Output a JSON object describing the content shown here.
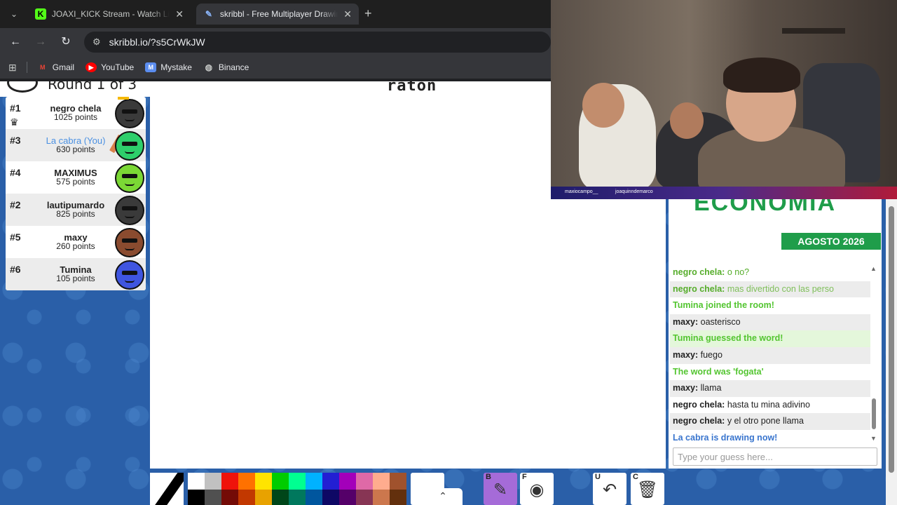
{
  "browser": {
    "tabs": [
      {
        "title": "JOAXI_KICK Stream - Watch Live",
        "favicon": "kick-icon"
      },
      {
        "title": "skribbl - Free Multiplayer Drawing",
        "favicon": "skribbl-icon"
      }
    ],
    "url": "skribbl.io/?s5CrWkJW",
    "bookmarks": [
      {
        "label": "Gmail",
        "icon": "gmail-icon"
      },
      {
        "label": "YouTube",
        "icon": "youtube-icon"
      },
      {
        "label": "Mystake",
        "icon": "mystake-icon"
      },
      {
        "label": "Binance",
        "icon": "globe-icon"
      }
    ]
  },
  "game": {
    "round_text": "Round 1 of 3",
    "word_hint": "raton",
    "players": [
      {
        "rank": "#1",
        "name": "negro chela",
        "points": "1025 points",
        "avatar_color": "#3a3a3a",
        "you": false,
        "owner": true
      },
      {
        "rank": "#3",
        "name": "La cabra (You)",
        "points": "630 points",
        "avatar_color": "#2ecf6b",
        "you": true,
        "drawing": true
      },
      {
        "rank": "#4",
        "name": "MAXIMUS",
        "points": "575 points",
        "avatar_color": "#7bd835",
        "you": false
      },
      {
        "rank": "#2",
        "name": "lautipumardo",
        "points": "825 points",
        "avatar_color": "#3a3a3a",
        "you": false
      },
      {
        "rank": "#5",
        "name": "maxy",
        "points": "260 points",
        "avatar_color": "#8a4b2f",
        "you": false
      },
      {
        "rank": "#6",
        "name": "Tumina",
        "points": "105 points",
        "avatar_color": "#3f55e0",
        "you": false
      }
    ]
  },
  "chat": {
    "banner_title": "ECONOMIA",
    "banner_date": "AGOSTO 2026",
    "messages": [
      {
        "author": "negro chela:",
        "text": "o no?",
        "style": "green-author"
      },
      {
        "author": "negro chela:",
        "text": "mas divertido con las perso",
        "style": "green-author lt"
      },
      {
        "author": "",
        "text": "Tumina joined the room!",
        "style": "green"
      },
      {
        "author": "maxy:",
        "text": "oasterisco",
        "style": ""
      },
      {
        "author": "",
        "text": "Tumina guessed the word!",
        "style": "green green-bg"
      },
      {
        "author": "maxy:",
        "text": "fuego",
        "style": ""
      },
      {
        "author": "",
        "text": "The word was 'fogata'",
        "style": "green"
      },
      {
        "author": "maxy:",
        "text": "llama",
        "style": ""
      },
      {
        "author": "negro chela:",
        "text": "hasta tu mina adivino",
        "style": ""
      },
      {
        "author": "negro chela:",
        "text": "y el otro pone llama",
        "style": ""
      },
      {
        "author": "",
        "text": "La cabra is drawing now!",
        "style": "blue"
      }
    ],
    "input_placeholder": "Type your guess here..."
  },
  "palette": {
    "colors": [
      "#ffffff",
      "#c1c1c1",
      "#ef130b",
      "#ff7100",
      "#ffe400",
      "#00cc00",
      "#00ff91",
      "#00b2ff",
      "#231fd3",
      "#a300ba",
      "#df69a7",
      "#ffac8e",
      "#a0522d",
      "#000000",
      "#505050",
      "#740b07",
      "#c23800",
      "#e8a200",
      "#004619",
      "#00785d",
      "#00569e",
      "#0e0865",
      "#550069",
      "#873554",
      "#cc774d",
      "#63300d"
    ]
  },
  "tools": [
    {
      "key": "B",
      "name": "brush-tool",
      "glyph": "✎",
      "active": true
    },
    {
      "key": "F",
      "name": "fill-tool",
      "glyph": "◉",
      "active": false
    },
    {
      "key": "U",
      "name": "undo-tool",
      "glyph": "↶",
      "active": false
    },
    {
      "key": "C",
      "name": "clear-tool",
      "glyph": "🗑",
      "active": false
    }
  ],
  "webcam": {
    "labels": [
      "maxiocampo__",
      "joaquinndemarco"
    ]
  }
}
